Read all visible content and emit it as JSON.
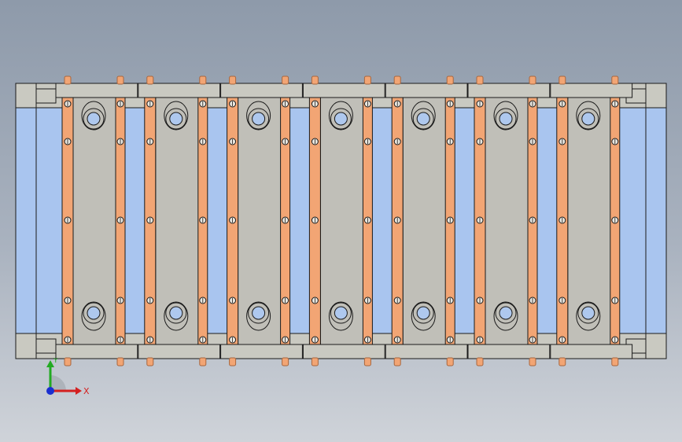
{
  "scene": {
    "module_count": 7,
    "colors": {
      "background_top": "#8e9aaa",
      "background_bottom": "#cfd3d9",
      "base_light_blue": "#a9c5ef",
      "frame_gray": "#c9c9c1",
      "panel_gray": "#c0bfb8",
      "copper_strip": "#f2a574",
      "copper_dark": "#a8663e",
      "hole_blue": "#aec8ee",
      "outline": "#1a1a1a"
    },
    "icons": [
      "screw-icon",
      "slot-hole-icon"
    ]
  },
  "triad": {
    "x_label": "X",
    "y_label": "Y",
    "x_color": "#d42020",
    "y_color": "#22aa22",
    "z_color": "#1a2fd0"
  }
}
